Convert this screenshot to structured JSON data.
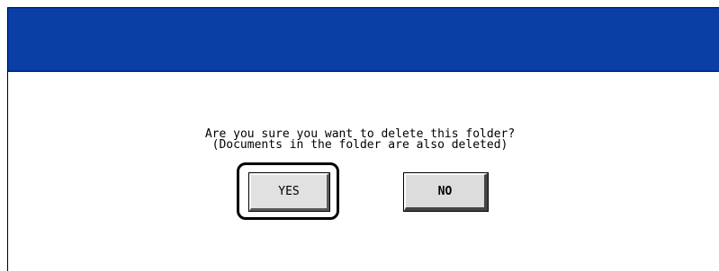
{
  "dialog": {
    "message_line1": "Are you sure you want to delete this folder?",
    "message_line2": "(Documents in the folder are also deleted)",
    "yes_label": "YES",
    "no_label": "NO"
  },
  "colors": {
    "header": "#0a3fa6",
    "button_face": "#e1e1e1",
    "background": "#ffffff"
  }
}
